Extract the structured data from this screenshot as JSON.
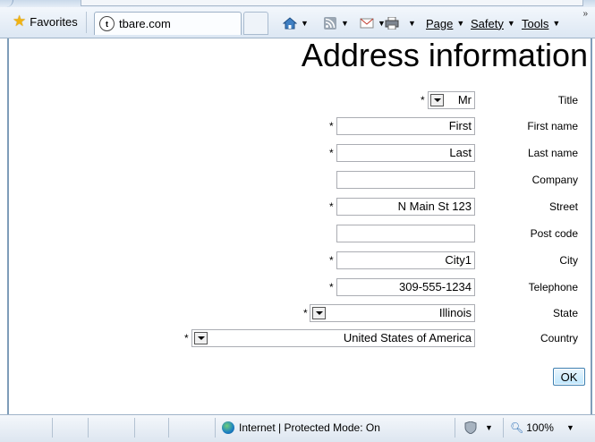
{
  "browser": {
    "favorites_label": "Favorites",
    "tab_title": "tbare.com",
    "favicon_letter": "t",
    "commands": {
      "page": "Page",
      "safety": "Safety",
      "tools": "Tools"
    },
    "more_chevron": "»",
    "status_text": "Internet | Protected Mode: On",
    "zoom": "100%"
  },
  "form": {
    "heading": "Address information",
    "required_marker": "*",
    "fields": {
      "title": {
        "label": "Title",
        "value": "Mr"
      },
      "first_name": {
        "label": "First name",
        "value": "First"
      },
      "last_name": {
        "label": "Last name",
        "value": "Last"
      },
      "company": {
        "label": "Company",
        "value": ""
      },
      "street": {
        "label": "Street",
        "value": "N Main St 123"
      },
      "post_code": {
        "label": "Post code",
        "value": ""
      },
      "city": {
        "label": "City",
        "value": "City1"
      },
      "telephone": {
        "label": "Telephone",
        "value": "309-555-1234"
      },
      "state": {
        "label": "State",
        "value": "Illinois"
      },
      "country": {
        "label": "Country",
        "value": "United States of America"
      }
    },
    "ok_label": "OK"
  }
}
